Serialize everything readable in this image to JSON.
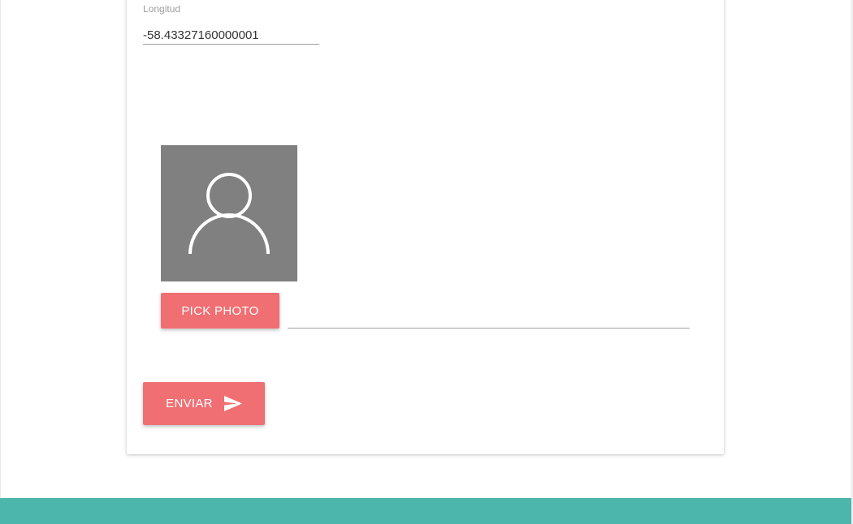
{
  "form": {
    "longitude_label": "Longitud",
    "longitude_value": "-58.43327160000001",
    "photo_filename": "",
    "pick_photo_label": "PICK PHOTO",
    "send_label": "ENVIAR"
  },
  "icons": {
    "avatar": "person-placeholder-icon",
    "send": "send-icon"
  },
  "colors": {
    "button": "#f06f73",
    "footer": "#4db6ac",
    "avatar_bg": "#808080"
  }
}
